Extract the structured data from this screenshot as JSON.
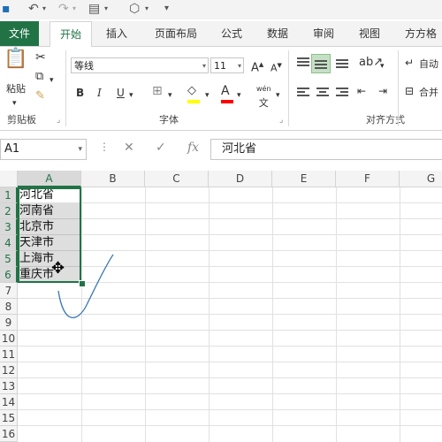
{
  "tabs": [
    "文件",
    "开始",
    "插入",
    "页面布局",
    "公式",
    "数据",
    "审阅",
    "视图",
    "方方格"
  ],
  "ribbon": {
    "clipboard": {
      "paste_label": "粘贴",
      "group_label": "剪贴板"
    },
    "font": {
      "font_name": "等线",
      "font_size": "11",
      "grow": "A",
      "shrink": "A",
      "bold": "B",
      "italic": "I",
      "underline": "U",
      "color_letter": "A",
      "phonetic": "wén",
      "group_label": "字体"
    },
    "alignment": {
      "wrap_label": "自动",
      "merge_label": "合并",
      "group_label": "对齐方式"
    },
    "colors": {
      "highlight": "#ffff00",
      "font_color": "#ff0000",
      "accent": "#217346"
    }
  },
  "formula_bar": {
    "name_box": "A1",
    "fx": "fx",
    "content": "河北省"
  },
  "sheet": {
    "columns": [
      "A",
      "B",
      "C",
      "D",
      "E",
      "F",
      "G"
    ],
    "rows": [
      "1",
      "2",
      "3",
      "4",
      "5",
      "6",
      "7",
      "8",
      "9",
      "10",
      "11",
      "12",
      "13",
      "14",
      "15",
      "16"
    ],
    "cells_A": [
      "河北省",
      "河南省",
      "北京市",
      "天津市",
      "上海市",
      "重庆市"
    ]
  }
}
